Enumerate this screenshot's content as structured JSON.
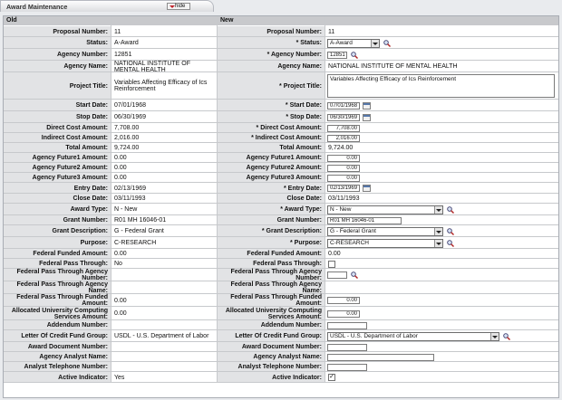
{
  "window": {
    "title": "Award Maintenance",
    "hide_label": "hide"
  },
  "columns": {
    "old": "Old",
    "new": "New"
  },
  "rows": [
    {
      "old_label": "Proposal Number:",
      "old_value": "11",
      "new_label": "Proposal Number:",
      "new_value": "11"
    },
    {
      "old_label": "Status:",
      "old_value": "A-Award",
      "new_label": "* Status:",
      "new_value": "A-Award"
    },
    {
      "old_label": "Agency Number:",
      "old_value": "12851",
      "new_label": "* Agency Number:",
      "new_value": "12851"
    },
    {
      "old_label": "Agency Name:",
      "old_value": "NATIONAL INSTITUTE OF MENTAL HEALTH",
      "new_label": "Agency Name:",
      "new_value": "NATIONAL INSTITUTE OF MENTAL HEALTH"
    },
    {
      "old_label": "Project Title:",
      "old_value": "Variables Affecting Efficacy of Ics Reinforcement",
      "new_label": "* Project Title:",
      "new_value": "Variables Affecting Efficacy of Ics Reinforcement"
    },
    {
      "old_label": "Start Date:",
      "old_value": "07/01/1968",
      "new_label": "* Start Date:",
      "new_value": "07/01/1968"
    },
    {
      "old_label": "Stop Date:",
      "old_value": "06/30/1969",
      "new_label": "* Stop Date:",
      "new_value": "06/30/1969"
    },
    {
      "old_label": "Direct Cost Amount:",
      "old_value": "7,708.00",
      "new_label": "* Direct Cost Amount:",
      "new_value": "7,708.00"
    },
    {
      "old_label": "Indirect Cost Amount:",
      "old_value": "2,016.00",
      "new_label": "* Indirect Cost Amount:",
      "new_value": "2,016.00"
    },
    {
      "old_label": "Total Amount:",
      "old_value": "9,724.00",
      "new_label": "Total Amount:",
      "new_value": "9,724.00"
    },
    {
      "old_label": "Agency Future1 Amount:",
      "old_value": "0.00",
      "new_label": "Agency Future1 Amount:",
      "new_value": "0.00"
    },
    {
      "old_label": "Agency Future2 Amount:",
      "old_value": "0.00",
      "new_label": "Agency Future2 Amount:",
      "new_value": "0.00"
    },
    {
      "old_label": "Agency Future3 Amount:",
      "old_value": "0.00",
      "new_label": "Agency Future3 Amount:",
      "new_value": "0.00"
    },
    {
      "old_label": "Entry Date:",
      "old_value": "02/13/1969",
      "new_label": "* Entry Date:",
      "new_value": "02/13/1969"
    },
    {
      "old_label": "Close Date:",
      "old_value": "03/11/1993",
      "new_label": "Close Date:",
      "new_value": "03/11/1993"
    },
    {
      "old_label": "Award Type:",
      "old_value": "N - New",
      "new_label": "* Award Type:",
      "new_value": "N - New"
    },
    {
      "old_label": "Grant Number:",
      "old_value": "R01 MH 16046-01",
      "new_label": "Grant Number:",
      "new_value": "R01 MH 16046-01"
    },
    {
      "old_label": "Grant Description:",
      "old_value": "G - Federal Grant",
      "new_label": "* Grant Description:",
      "new_value": "G - Federal Grant"
    },
    {
      "old_label": "Purpose:",
      "old_value": "C-RESEARCH",
      "new_label": "* Purpose:",
      "new_value": "C-RESEARCH"
    },
    {
      "old_label": "Federal Funded Amount:",
      "old_value": "0.00",
      "new_label": "Federal Funded Amount:",
      "new_value": "0.00"
    },
    {
      "old_label": "Federal Pass Through:",
      "old_value": "No",
      "new_label": "Federal Pass Through:",
      "new_value": ""
    },
    {
      "old_label": "Federal Pass Through Agency Number:",
      "old_value": "",
      "new_label": "Federal Pass Through Agency Number:",
      "new_value": ""
    },
    {
      "old_label": "Federal Pass Through Agency Name:",
      "old_value": "",
      "new_label": "Federal Pass Through Agency Name:",
      "new_value": ""
    },
    {
      "old_label": "Federal Pass Through Funded Amount:",
      "old_value": "0.00",
      "new_label": "Federal Pass Through Funded Amount:",
      "new_value": "0.00"
    },
    {
      "old_label": "Allocated University Computing Services Amount:",
      "old_value": "0.00",
      "new_label": "Allocated University Computing Services Amount:",
      "new_value": "0.00"
    },
    {
      "old_label": "Addendum Number:",
      "old_value": "",
      "new_label": "Addendum Number:",
      "new_value": ""
    },
    {
      "old_label": "Letter Of Credit Fund Group:",
      "old_value": "USDL - U.S. Department of Labor",
      "new_label": "Letter Of Credit Fund Group:",
      "new_value": "USDL - U.S. Department of Labor"
    },
    {
      "old_label": "Award Document Number:",
      "old_value": "",
      "new_label": "Award Document Number:",
      "new_value": ""
    },
    {
      "old_label": "Agency Analyst Name:",
      "old_value": "",
      "new_label": "Agency Analyst Name:",
      "new_value": ""
    },
    {
      "old_label": "Analyst Telephone Number:",
      "old_value": "",
      "new_label": "Analyst Telephone Number:",
      "new_value": ""
    },
    {
      "old_label": "Active Indicator:",
      "old_value": "Yes",
      "new_label": "Active Indicator:",
      "new_value": "✓"
    }
  ]
}
